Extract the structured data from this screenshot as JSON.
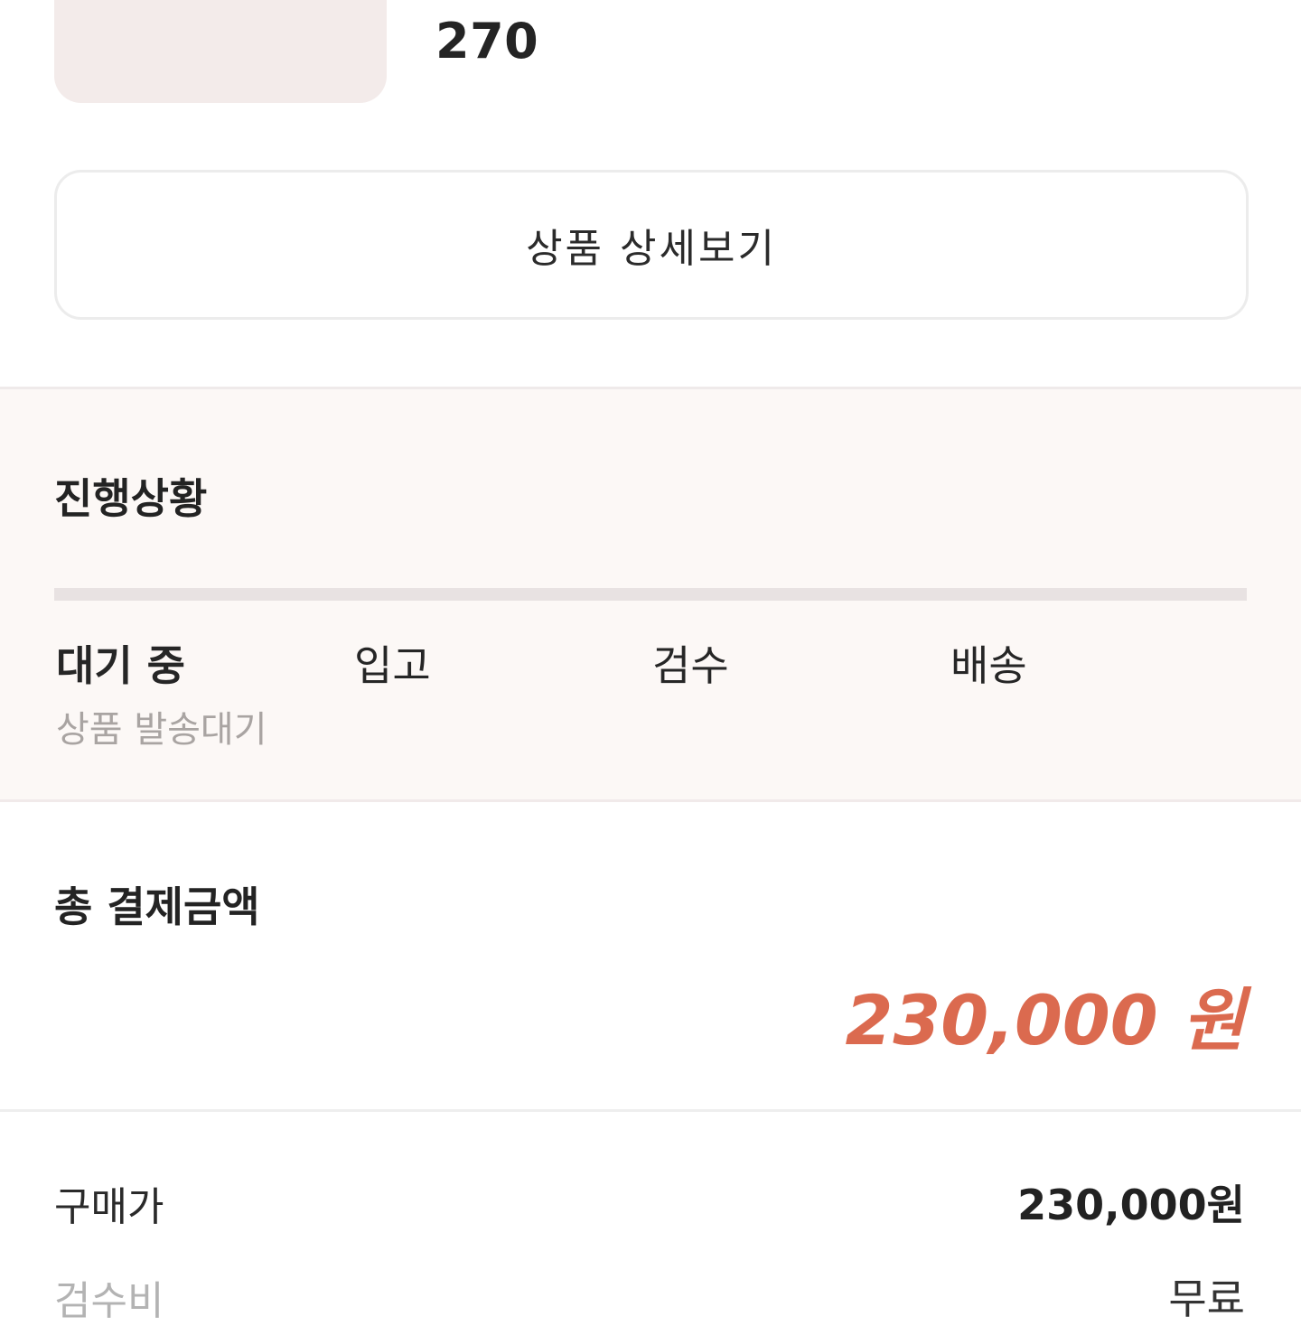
{
  "product": {
    "size": "270"
  },
  "detail_button": {
    "label": "상품 상세보기"
  },
  "progress": {
    "title": "진행상황",
    "steps": [
      {
        "label": "대기 중",
        "sub": "상품 발송대기",
        "active": true
      },
      {
        "label": "입고",
        "sub": "",
        "active": false
      },
      {
        "label": "검수",
        "sub": "",
        "active": false
      },
      {
        "label": "배송",
        "sub": "",
        "active": false
      }
    ]
  },
  "total": {
    "title": "총 결제금액",
    "amount": "230,000 원",
    "amount_color": "#db6a4f"
  },
  "breakdown": [
    {
      "label": "구매가",
      "value": "230,000원"
    },
    {
      "label": "검수비",
      "value": "무료"
    }
  ]
}
